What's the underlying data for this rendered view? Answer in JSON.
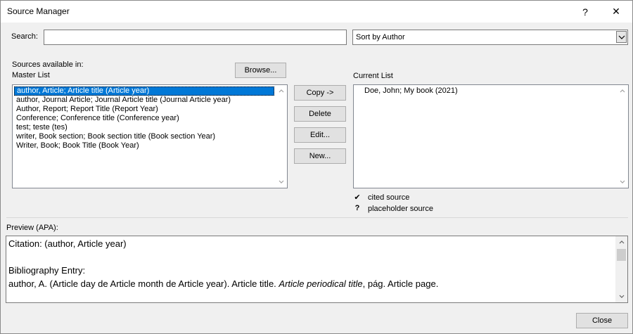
{
  "window": {
    "title": "Source Manager",
    "help_glyph": "?",
    "close_glyph": "✕"
  },
  "search": {
    "label": "Search:",
    "value": "",
    "placeholder": ""
  },
  "sort": {
    "selected": "Sort by Author"
  },
  "sources": {
    "label": "Sources available in:",
    "browse_label": "Browse...",
    "master_label": "Master List",
    "master_items": [
      "author, Article; Article title (Article year)",
      "author, Journal Article; Journal Article title (Journal Article year)",
      "Author, Report; Report Title (Report Year)",
      "Conference; Conference title (Conference year)",
      "test; teste (tes)",
      "writer, Book section; Book section title (Book section Year)",
      "Writer, Book; Book Title (Book Year)"
    ],
    "current_label": "Current List",
    "current_items": [
      "Doe, John; My book (2021)"
    ]
  },
  "actions": {
    "copy_label": "Copy ->",
    "delete_label": "Delete",
    "edit_label": "Edit...",
    "new_label": "New..."
  },
  "legend": {
    "cited_icon": "✔",
    "cited_label": "cited source",
    "placeholder_icon": "?",
    "placeholder_label": "placeholder source"
  },
  "preview": {
    "label": "Preview (APA):",
    "citation": "Citation:  (author, Article year)",
    "bibliography_heading": "Bibliography Entry:",
    "entry_part1": "author, A. (Article day de Article month de Article year). Article title. ",
    "entry_italic": "Article periodical title",
    "entry_part2": ", pág. Article page."
  },
  "footer": {
    "close_label": "Close"
  }
}
